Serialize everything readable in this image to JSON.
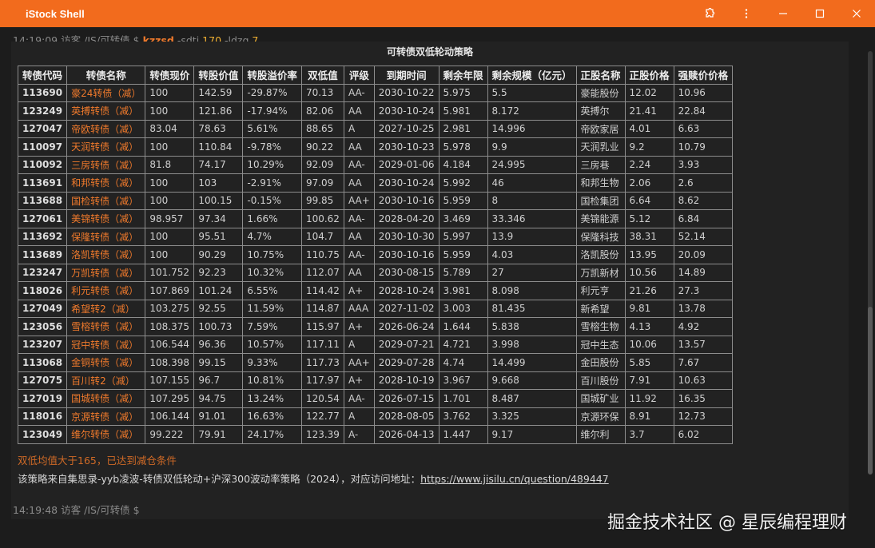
{
  "window": {
    "title": "iStock Shell",
    "accent": "#f26b1d"
  },
  "prompt1": {
    "time": "14:19:09",
    "user": "访客",
    "path": "/IS/可转债",
    "sym": "$",
    "cmd": "kzzsd",
    "flag1": "-sdtj",
    "val1": "170",
    "flag2": "-ldzq",
    "val2": "7"
  },
  "table": {
    "title": "可转债双低轮动策略",
    "headers": [
      "转债代码",
      "转债名称",
      "转债现价",
      "转股价值",
      "转股溢价率",
      "双低值",
      "评级",
      "到期时间",
      "剩余年限",
      "剩余规模（亿元）",
      "正股名称",
      "正股价格",
      "强赎价价格"
    ],
    "rows": [
      [
        "113690",
        "豪24转债（减）",
        "100",
        "142.59",
        "-29.87%",
        "70.13",
        "AA-",
        "2030-10-22",
        "5.975",
        "5.5",
        "豪能股份",
        "12.02",
        "10.96"
      ],
      [
        "123249",
        "英搏转债（减）",
        "100",
        "121.86",
        "-17.94%",
        "82.06",
        "AA",
        "2030-10-24",
        "5.981",
        "8.172",
        "英搏尔",
        "21.41",
        "22.84"
      ],
      [
        "127047",
        "帝欧转债（减）",
        "83.04",
        "78.63",
        "5.61%",
        "88.65",
        "A",
        "2027-10-25",
        "2.981",
        "14.996",
        "帝欧家居",
        "4.01",
        "6.63"
      ],
      [
        "110097",
        "天润转债（减）",
        "100",
        "110.84",
        "-9.78%",
        "90.22",
        "AA",
        "2030-10-23",
        "5.978",
        "9.9",
        "天润乳业",
        "9.2",
        "10.79"
      ],
      [
        "110092",
        "三房转债（减）",
        "81.8",
        "74.17",
        "10.29%",
        "92.09",
        "AA-",
        "2029-01-06",
        "4.184",
        "24.995",
        "三房巷",
        "2.24",
        "3.93"
      ],
      [
        "113691",
        "和邦转债（减）",
        "100",
        "103",
        "-2.91%",
        "97.09",
        "AA",
        "2030-10-24",
        "5.992",
        "46",
        "和邦生物",
        "2.06",
        "2.6"
      ],
      [
        "113688",
        "国检转债（减）",
        "100",
        "100.15",
        "-0.15%",
        "99.85",
        "AA+",
        "2030-10-16",
        "5.959",
        "8",
        "国检集团",
        "6.64",
        "8.62"
      ],
      [
        "127061",
        "美锦转债（减）",
        "98.957",
        "97.34",
        "1.66%",
        "100.62",
        "AA-",
        "2028-04-20",
        "3.469",
        "33.346",
        "美锦能源",
        "5.12",
        "6.84"
      ],
      [
        "113692",
        "保隆转债（减）",
        "100",
        "95.51",
        "4.7%",
        "104.7",
        "AA",
        "2030-10-30",
        "5.997",
        "13.9",
        "保隆科技",
        "38.31",
        "52.14"
      ],
      [
        "113689",
        "洛凯转债（减）",
        "100",
        "90.29",
        "10.75%",
        "110.75",
        "AA-",
        "2030-10-16",
        "5.959",
        "4.03",
        "洛凯股份",
        "13.95",
        "20.09"
      ],
      [
        "123247",
        "万凯转债（减）",
        "101.752",
        "92.23",
        "10.32%",
        "112.07",
        "AA",
        "2030-08-15",
        "5.789",
        "27",
        "万凯新材",
        "10.56",
        "14.89"
      ],
      [
        "118026",
        "利元转债（减）",
        "107.869",
        "101.24",
        "6.55%",
        "114.42",
        "A+",
        "2028-10-24",
        "3.981",
        "8.098",
        "利元亨",
        "21.26",
        "27.3"
      ],
      [
        "127049",
        "希望转2（减）",
        "103.275",
        "92.55",
        "11.59%",
        "114.87",
        "AAA",
        "2027-11-02",
        "3.003",
        "81.435",
        "新希望",
        "9.81",
        "13.78"
      ],
      [
        "123056",
        "雪榕转债（减）",
        "108.375",
        "100.73",
        "7.59%",
        "115.97",
        "A+",
        "2026-06-24",
        "1.644",
        "5.838",
        "雪榕生物",
        "4.13",
        "4.92"
      ],
      [
        "123207",
        "冠中转债（减）",
        "106.544",
        "96.36",
        "10.57%",
        "117.11",
        "A",
        "2029-07-21",
        "4.721",
        "3.998",
        "冠中生态",
        "10.06",
        "13.57"
      ],
      [
        "113068",
        "金铜转债（减）",
        "108.398",
        "99.15",
        "9.33%",
        "117.73",
        "AA+",
        "2029-07-28",
        "4.74",
        "14.499",
        "金田股份",
        "5.85",
        "7.67"
      ],
      [
        "127075",
        "百川转2（减）",
        "107.155",
        "96.7",
        "10.81%",
        "117.97",
        "A+",
        "2028-10-19",
        "3.967",
        "9.668",
        "百川股份",
        "7.91",
        "10.63"
      ],
      [
        "127019",
        "国城转债（减）",
        "107.295",
        "94.75",
        "13.24%",
        "120.54",
        "AA-",
        "2026-07-15",
        "1.701",
        "8.487",
        "国城矿业",
        "11.92",
        "16.35"
      ],
      [
        "118016",
        "京源转债（减）",
        "106.144",
        "91.01",
        "16.63%",
        "122.77",
        "A",
        "2028-08-05",
        "3.762",
        "3.325",
        "京源环保",
        "8.91",
        "12.73"
      ],
      [
        "123049",
        "维尔转债（减）",
        "99.222",
        "79.91",
        "24.17%",
        "123.39",
        "A-",
        "2026-04-13",
        "1.447",
        "9.17",
        "维尔利",
        "3.7",
        "6.02"
      ]
    ]
  },
  "warning": "双低均值大于165，已达到减仓条件",
  "note": {
    "text": "该策略来自集思录-yyb凌波-转债双低轮动+沪深300波动率策略（2024），对应访问地址：",
    "link": "https://www.jisilu.cn/question/489447"
  },
  "prompt2": {
    "time": "14:19:48",
    "user": "访客",
    "path": "/IS/可转债",
    "sym": "$"
  },
  "watermark": "掘金技术社区 @ 星辰编程理财"
}
